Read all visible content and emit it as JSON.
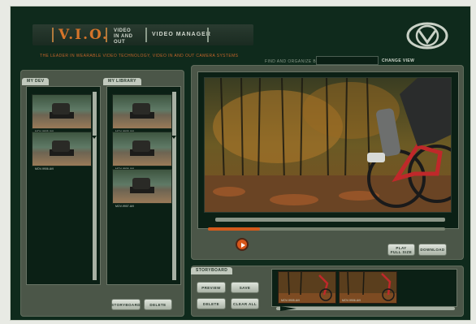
{
  "header": {
    "logo": "V.I.O.",
    "subtitle_line1": "VIDEO",
    "subtitle_line2": "IN AND OUT",
    "title": "VIDEO MANAGER",
    "tagline": "THE LEADER IN WEARABLE VIDEO TECHNOLOGY, VIDEO IN AND OUT CAMERA SYSTEMS"
  },
  "search": {
    "label": "FIND AND ORGANIZE BY KE",
    "value": "",
    "button_label": "CHANGE VIEW"
  },
  "my_dev": {
    "tab_label": "MY DEV",
    "clips": [
      {
        "caption": "MOV-9905.AVI"
      },
      {
        "caption": "MOV-9906.AVI"
      }
    ],
    "buttons": {
      "storyboard": "STORYBOARD",
      "delete": "DELETE"
    }
  },
  "my_library": {
    "tab_label": "MY LIBRARY",
    "clips": [
      {
        "caption": "MOV-9905.AVI"
      },
      {
        "caption": "MOV-9906.AVI"
      },
      {
        "caption": "MOV-9907.AVI"
      }
    ]
  },
  "player": {
    "play_label": "play",
    "playback_progress": 0.22,
    "buttons": {
      "full_size_line1": "PLAY",
      "full_size_line2": "FULL SIZE",
      "download": "DOWNLOAD"
    }
  },
  "storyboard": {
    "tab_label": "STORYBOARD",
    "buttons": {
      "preview": "PREVIEW",
      "save": "SAVE",
      "delete": "DELETE",
      "clear_all": "CLEAR ALL"
    },
    "clips": [
      {
        "caption": "MOV-9905.AVI"
      },
      {
        "caption": "MOV-9906.AVI"
      }
    ]
  },
  "colors": {
    "background": "#0f2a1c",
    "accent": "#d5742a",
    "panel": "#4b5648"
  }
}
